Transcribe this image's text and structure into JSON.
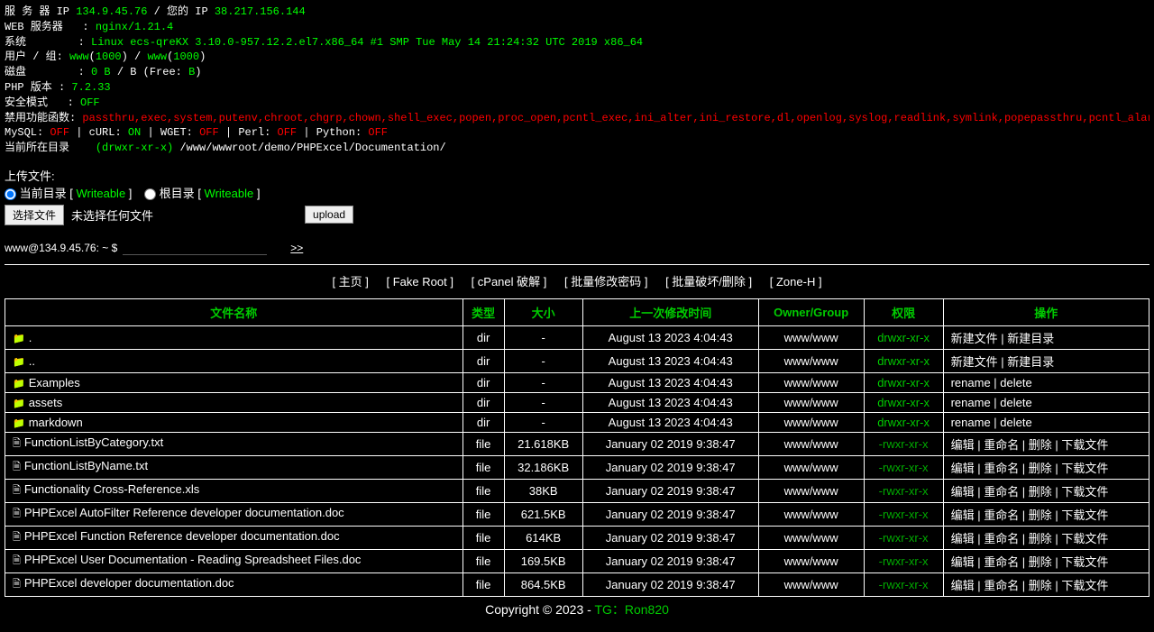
{
  "info": {
    "server_ip_label": "服 务 器  IP",
    "server_ip": "134.9.45.76",
    "your_ip_label": "您的 IP",
    "your_ip": "38.217.156.144",
    "web_server_label": "WEB 服务器",
    "web_server": "nginx/1.21.4",
    "system_label": "系统",
    "system": "Linux ecs-qreKX 3.10.0-957.12.2.el7.x86_64 #1 SMP Tue May 14 21:24:32 UTC 2019 x86_64",
    "user_group_label": "用户 / 组:",
    "user": "www",
    "uid": "1000",
    "group": "www",
    "gid": "1000",
    "disk_label": "磁盘",
    "disk_total": "0 B",
    "disk_free_label": "Free:",
    "disk_free": "B",
    "php_label": "PHP 版本 :",
    "php_version": "7.2.33",
    "safe_mode_label": "安全模式",
    "safe_mode": "OFF",
    "disabled_label": "禁用功能函数:",
    "disabled_funcs": "passthru,exec,system,putenv,chroot,chgrp,chown,shell_exec,popen,proc_open,pcntl_exec,ini_alter,ini_restore,dl,openlog,syslog,readlink,symlink,popepassthru,pcntl_alarm,pcntl_fork,pcntl_waitpid,pcntl_w",
    "mysql_label": "MySQL:",
    "mysql": "OFF",
    "curl_label": "cURL:",
    "curl": "ON",
    "wget_label": "WGET:",
    "wget": "OFF",
    "perl_label": "Perl:",
    "perl": "OFF",
    "python_label": "Python:",
    "python": "OFF",
    "cwd_label": "当前所在目录",
    "cwd_perms": "(drwxr-xr-x)",
    "cwd_path": "/www/wwwroot/demo/PHPExcel/Documentation/"
  },
  "upload": {
    "title": "上传文件:",
    "current_dir_label": "当前目录",
    "root_dir_label": "根目录",
    "writeable": "Writeable",
    "choose_file": "选择文件",
    "no_file": "未选择任何文件",
    "upload_btn": "upload"
  },
  "cmd": {
    "prompt": "www@134.9.45.76: ~ $",
    "go": ">>"
  },
  "nav": {
    "home": "[ 主页 ]",
    "fake_root": "[ Fake Root ]",
    "cpanel": "[ cPanel 破解 ]",
    "mass_pass": "[ 批量修改密码 ]",
    "mass_destroy": "[ 批量破坏/删除 ]",
    "zoneh": "[ Zone-H ]"
  },
  "table": {
    "headers": {
      "name": "文件名称",
      "type": "类型",
      "size": "大小",
      "mtime": "上一次修改时间",
      "owner": "Owner/Group",
      "perms": "权限",
      "action": "操作"
    },
    "dir_action": "新建文件 | 新建目录",
    "folder_action": "rename | delete",
    "file_action": "编辑 | 重命名 | 删除 | 下载文件",
    "rows": [
      {
        "icon": "folder",
        "name": ".",
        "type": "dir",
        "size": "-",
        "mtime": "August 13 2023 4:04:43",
        "owner": "www/www",
        "perms": "drwxr-xr-x",
        "action_key": "dir_action"
      },
      {
        "icon": "folder",
        "name": "..",
        "type": "dir",
        "size": "-",
        "mtime": "August 13 2023 4:04:43",
        "owner": "www/www",
        "perms": "drwxr-xr-x",
        "action_key": "dir_action"
      },
      {
        "icon": "folder",
        "name": "Examples",
        "type": "dir",
        "size": "-",
        "mtime": "August 13 2023 4:04:43",
        "owner": "www/www",
        "perms": "drwxr-xr-x",
        "action_key": "folder_action"
      },
      {
        "icon": "folder",
        "name": "assets",
        "type": "dir",
        "size": "-",
        "mtime": "August 13 2023 4:04:43",
        "owner": "www/www",
        "perms": "drwxr-xr-x",
        "action_key": "folder_action"
      },
      {
        "icon": "folder",
        "name": "markdown",
        "type": "dir",
        "size": "-",
        "mtime": "August 13 2023 4:04:43",
        "owner": "www/www",
        "perms": "drwxr-xr-x",
        "action_key": "folder_action"
      },
      {
        "icon": "file",
        "name": "FunctionListByCategory.txt",
        "type": "file",
        "size": "21.618KB",
        "mtime": "January 02 2019 9:38:47",
        "owner": "www/www",
        "perms": "-rwxr-xr-x",
        "action_key": "file_action"
      },
      {
        "icon": "file",
        "name": "FunctionListByName.txt",
        "type": "file",
        "size": "32.186KB",
        "mtime": "January 02 2019 9:38:47",
        "owner": "www/www",
        "perms": "-rwxr-xr-x",
        "action_key": "file_action"
      },
      {
        "icon": "file",
        "name": "Functionality Cross-Reference.xls",
        "type": "file",
        "size": "38KB",
        "mtime": "January 02 2019 9:38:47",
        "owner": "www/www",
        "perms": "-rwxr-xr-x",
        "action_key": "file_action"
      },
      {
        "icon": "file",
        "name": "PHPExcel AutoFilter Reference developer documentation.doc",
        "type": "file",
        "size": "621.5KB",
        "mtime": "January 02 2019 9:38:47",
        "owner": "www/www",
        "perms": "-rwxr-xr-x",
        "action_key": "file_action"
      },
      {
        "icon": "file",
        "name": "PHPExcel Function Reference developer documentation.doc",
        "type": "file",
        "size": "614KB",
        "mtime": "January 02 2019 9:38:47",
        "owner": "www/www",
        "perms": "-rwxr-xr-x",
        "action_key": "file_action"
      },
      {
        "icon": "file",
        "name": "PHPExcel User Documentation - Reading Spreadsheet Files.doc",
        "type": "file",
        "size": "169.5KB",
        "mtime": "January 02 2019 9:38:47",
        "owner": "www/www",
        "perms": "-rwxr-xr-x",
        "action_key": "file_action"
      },
      {
        "icon": "file",
        "name": "PHPExcel developer documentation.doc",
        "type": "file",
        "size": "864.5KB",
        "mtime": "January 02 2019 9:38:47",
        "owner": "www/www",
        "perms": "-rwxr-xr-x",
        "action_key": "file_action"
      }
    ]
  },
  "footer": {
    "copyright": "Copyright © 2023 - ",
    "tg": "TG：Ron820"
  }
}
